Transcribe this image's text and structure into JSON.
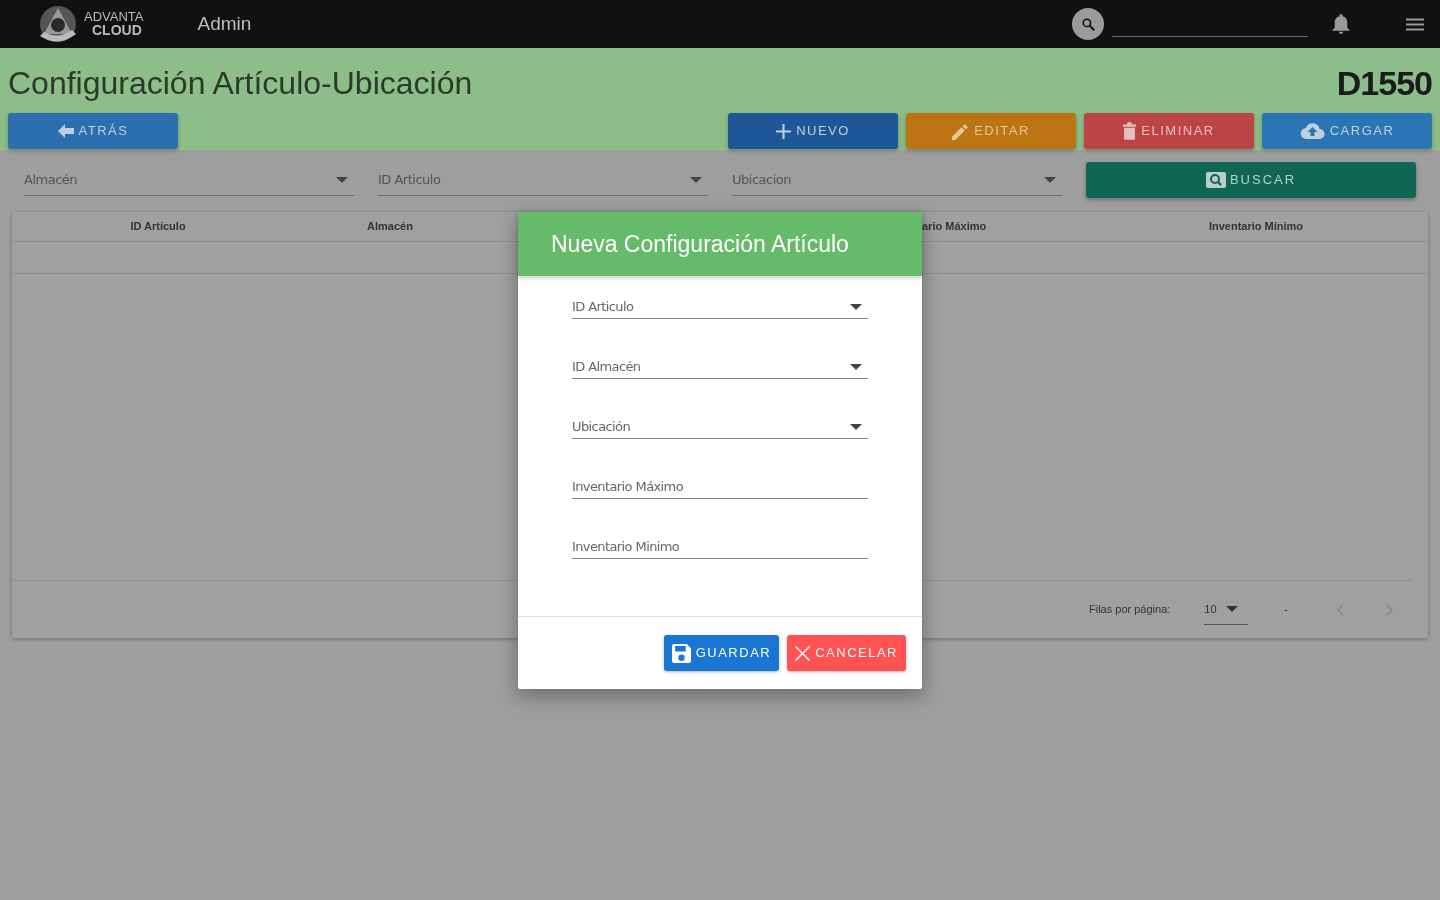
{
  "topbar": {
    "logo_line1": "ADVANTA",
    "logo_line2": "CLOUD",
    "section": "Admin"
  },
  "page": {
    "title": "Configuración Artículo-Ubicación",
    "code": "D1550"
  },
  "actions": [
    {
      "kind": "back",
      "label": "ATRÁS"
    },
    {
      "kind": "new",
      "label": "NUEVO"
    },
    {
      "kind": "edit",
      "label": "EDITAR"
    },
    {
      "kind": "delete",
      "label": "ELIMINAR"
    },
    {
      "kind": "upload",
      "label": "CARGAR"
    }
  ],
  "filters": [
    {
      "placeholder": "Almacén"
    },
    {
      "placeholder": "ID Articulo"
    },
    {
      "placeholder": "Ubicacion"
    }
  ],
  "search_button": "BUSCAR",
  "table": {
    "columns": [
      "ID Artículo",
      "Almacén",
      "ario Máximo",
      "Inventario Mínimo"
    ]
  },
  "pagination": {
    "rows_label": "Filas por página:",
    "rows_value": "10",
    "range": "-"
  },
  "modal": {
    "title": "Nueva Configuración Artículo",
    "fields": [
      {
        "kind": "select",
        "placeholder": "ID Articulo"
      },
      {
        "kind": "select",
        "placeholder": "ID Almacén"
      },
      {
        "kind": "select",
        "placeholder": "Ubicación"
      },
      {
        "kind": "text",
        "placeholder": "Inventario Máximo"
      },
      {
        "kind": "text",
        "placeholder": "Inventario Minimo"
      }
    ],
    "buttons": [
      {
        "kind": "save",
        "label": "GUARDAR"
      },
      {
        "kind": "cancel",
        "label": "CANCELAR"
      }
    ]
  }
}
